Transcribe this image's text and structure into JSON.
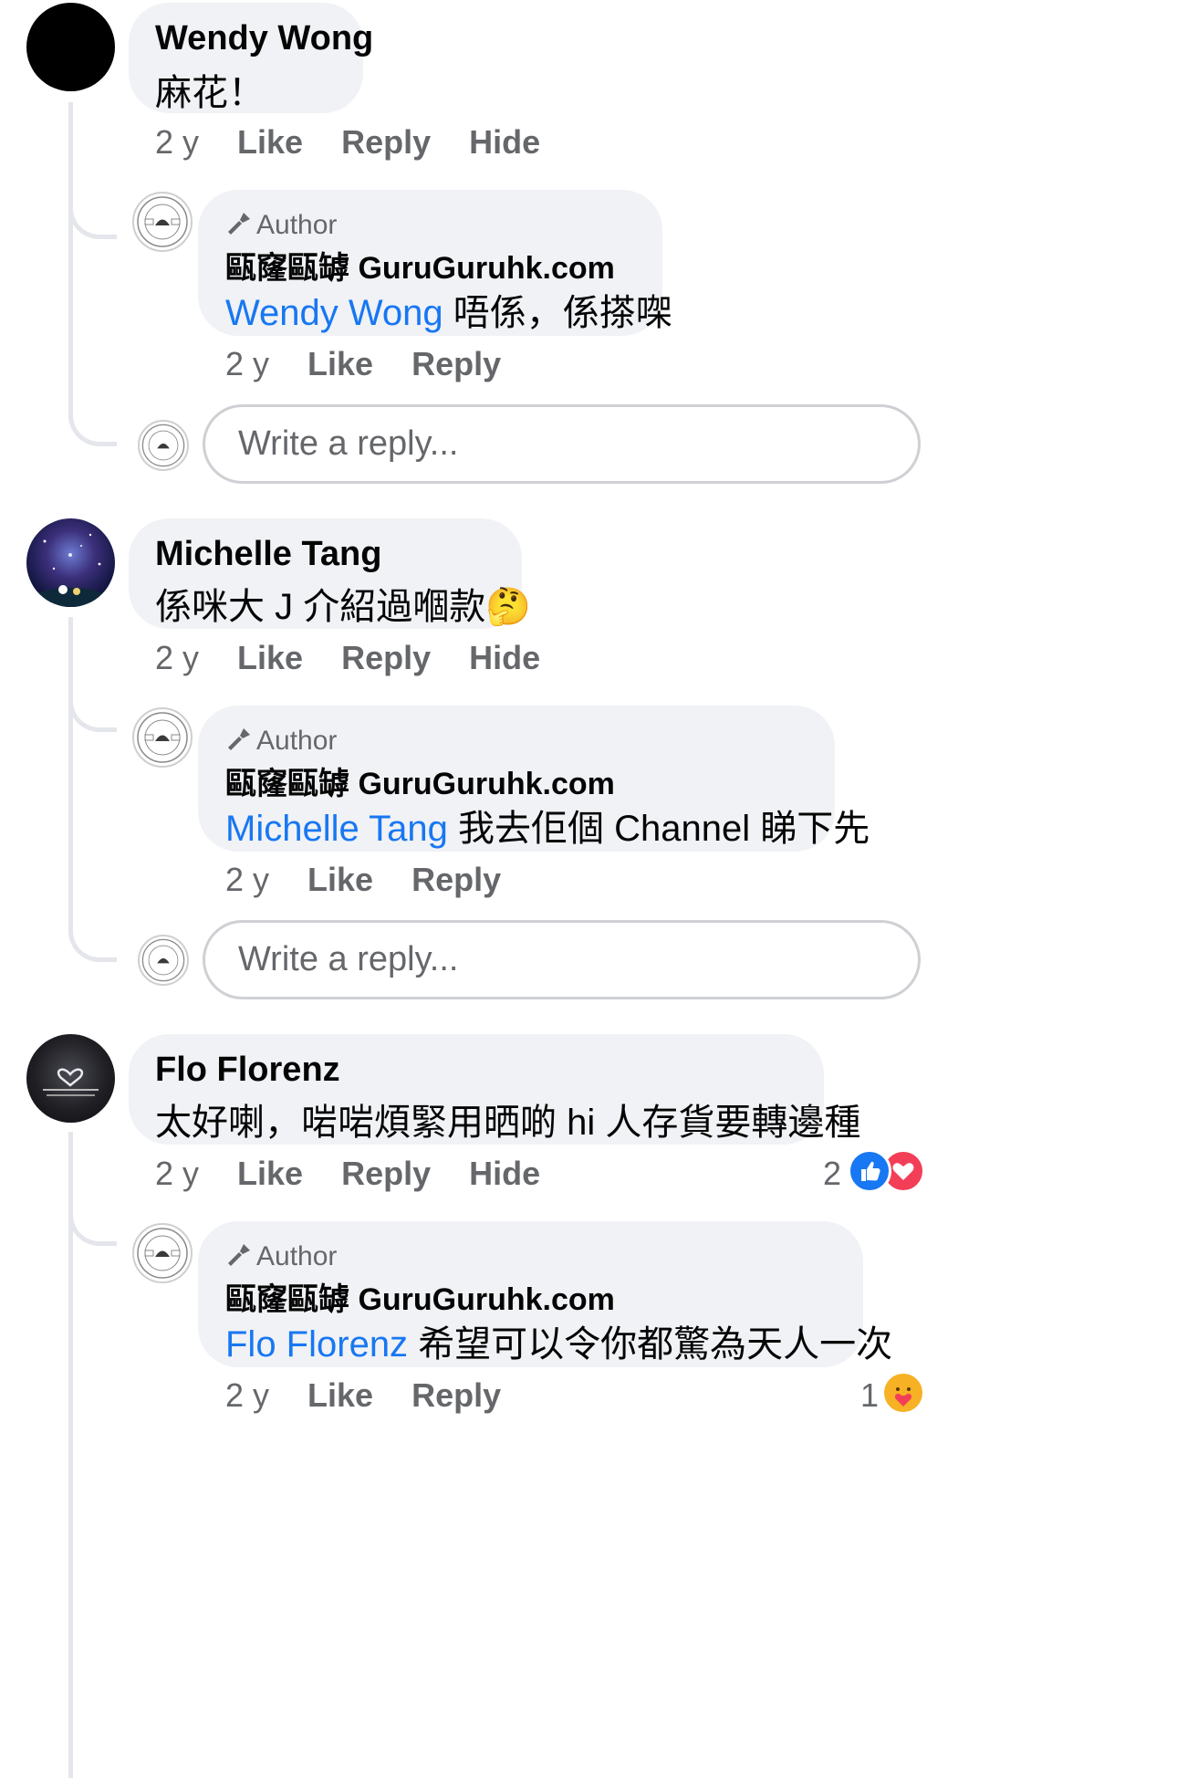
{
  "comments": [
    {
      "author": "Wendy Wong",
      "text": "麻花！",
      "time": "2 y",
      "like": "Like",
      "reply": "Reply",
      "hide": "Hide",
      "author_reply": {
        "badge": "Author",
        "name": "甌窿甌罅 GuruGuruhk.com",
        "mention": "Wendy Wong",
        "text": "唔係，係搽㗎",
        "time": "2 y",
        "like": "Like",
        "reply": "Reply"
      },
      "reply_placeholder": "Write a reply..."
    },
    {
      "author": "Michelle Tang",
      "text": "係咪大 J 介紹過嗰款",
      "emoji": "🤔",
      "time": "2 y",
      "like": "Like",
      "reply": "Reply",
      "hide": "Hide",
      "author_reply": {
        "badge": "Author",
        "name": "甌窿甌罅 GuruGuruhk.com",
        "mention": "Michelle Tang",
        "text": "我去佢個 Channel 睇下先",
        "time": "2 y",
        "like": "Like",
        "reply": "Reply"
      },
      "reply_placeholder": "Write a reply..."
    },
    {
      "author": "Flo Florenz",
      "text": "太好喇，啱啱煩緊用晒啲 hi 人存貨要轉邊種",
      "time": "2 y",
      "like": "Like",
      "reply": "Reply",
      "hide": "Hide",
      "reaction_count": "2",
      "reactions": [
        "like-icon",
        "love-icon"
      ],
      "author_reply": {
        "badge": "Author",
        "name": "甌窿甌罅 GuruGuruhk.com",
        "mention": "Flo Florenz",
        "text": "希望可以令你都驚為天人一次",
        "time": "2 y",
        "like": "Like",
        "reply": "Reply",
        "reaction_count": "1",
        "reactions": [
          "care-icon"
        ]
      }
    }
  ],
  "colors": {
    "mention": "#1877f2",
    "bubble": "#f0f2f5",
    "secondary_text": "#65676b",
    "like_blue": "#1877f2",
    "love_red": "#f33e58",
    "care_yellow": "#f7b125"
  }
}
